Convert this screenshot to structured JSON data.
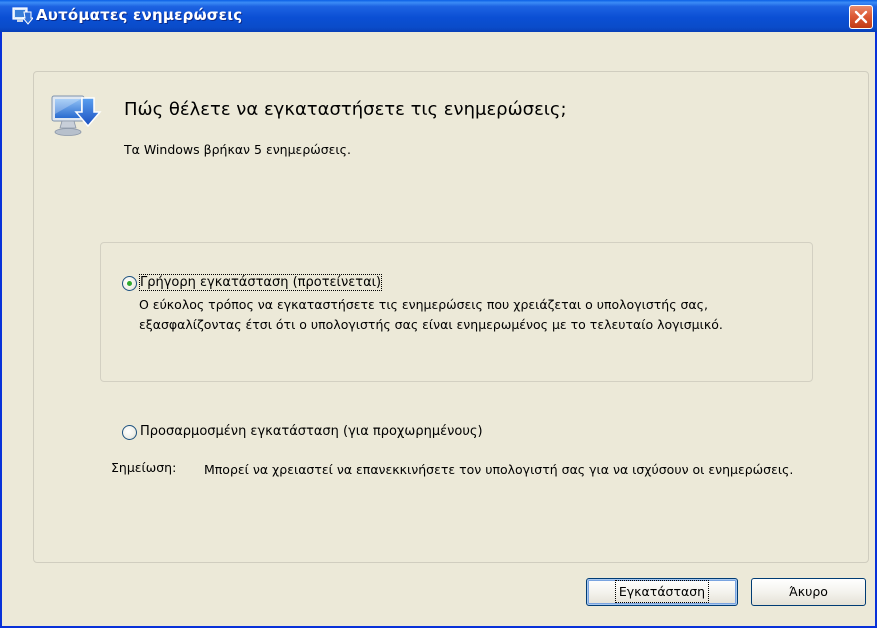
{
  "window": {
    "title": "Αυτόματες ενημερώσεις",
    "accent_color": "#0a4cc9",
    "close_icon": "close-icon"
  },
  "header": {
    "icon": "windows-update-icon",
    "title": "Πώς θέλετε να εγκαταστήσετε τις ενημερώσεις;",
    "subtitle": "Τα Windows βρήκαν 5 ενημερώσεις."
  },
  "options": {
    "express": {
      "label": "Γρήγορη εγκατάσταση (προτείνεται)",
      "selected": true,
      "description": "Ο εύκολος τρόπος να εγκαταστήσετε τις ενημερώσεις που χρειάζεται ο υπολογιστής σας, εξασφαλίζοντας έτσι ότι ο υπολογιστής σας είναι ενημερωμένος με το τελευταίο λογισμικό."
    },
    "custom": {
      "label": "Προσαρμοσμένη εγκατάσταση (για προχωρημένους)",
      "selected": false
    }
  },
  "note": {
    "label": "Σημείωση:",
    "text": "Μπορεί να χρειαστεί να επανεκκινήσετε τον υπολογιστή σας για να ισχύσουν οι ενημερώσεις."
  },
  "buttons": {
    "install_label": "Εγκατάσταση",
    "cancel_label": "Άκυρο"
  }
}
